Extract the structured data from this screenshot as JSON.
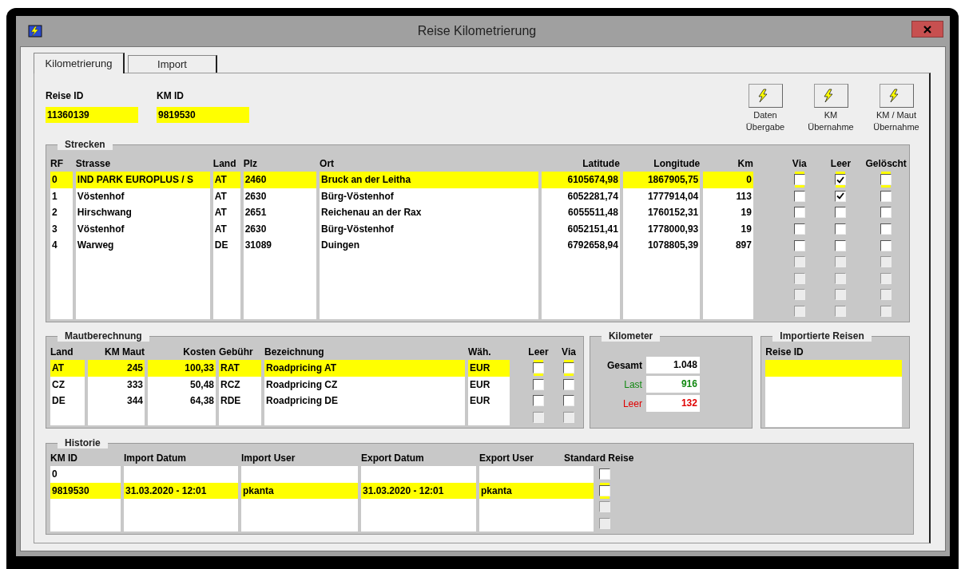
{
  "window": {
    "title": "Reise Kilometrierung"
  },
  "tabs": [
    {
      "label": "Kilometrierung",
      "selected": true
    },
    {
      "label": "Import",
      "selected": false
    }
  ],
  "header_fields": [
    {
      "label": "Reise ID",
      "value": "11360139"
    },
    {
      "label": "KM ID",
      "value": "9819530"
    }
  ],
  "toolbar_buttons": [
    {
      "lines": [
        "Daten",
        "Übergabe"
      ]
    },
    {
      "lines": [
        "KM",
        "Übernahme"
      ]
    },
    {
      "lines": [
        "KM / Maut",
        "Übernahme"
      ]
    }
  ],
  "strecken": {
    "title": "Strecken",
    "columns": [
      "RF",
      "Strasse",
      "Land",
      "Plz",
      "Ort",
      "Latitude",
      "Longitude",
      "Km",
      "Via",
      "Leer",
      "Gelöscht"
    ],
    "rows": [
      {
        "rf": "0",
        "strasse": "IND PARK EUROPLUS / S",
        "land": "AT",
        "plz": "2460",
        "ort": "Bruck an der Leitha",
        "latitude": "6105674,98",
        "longitude": "1867905,75",
        "km": "0",
        "via": false,
        "leer": true,
        "geloescht": false,
        "selected": true,
        "disabled": false
      },
      {
        "rf": "1",
        "strasse": "Vöstenhof",
        "land": "AT",
        "plz": "2630",
        "ort": "Bürg-Vöstenhof",
        "latitude": "6052281,74",
        "longitude": "1777914,04",
        "km": "113",
        "via": false,
        "leer": true,
        "geloescht": false,
        "selected": false,
        "disabled": false
      },
      {
        "rf": "2",
        "strasse": "Hirschwang",
        "land": "AT",
        "plz": "2651",
        "ort": "Reichenau an der Rax",
        "latitude": "6055511,48",
        "longitude": "1760152,31",
        "km": "19",
        "via": false,
        "leer": false,
        "geloescht": false,
        "selected": false,
        "disabled": false
      },
      {
        "rf": "3",
        "strasse": "Vöstenhof",
        "land": "AT",
        "plz": "2630",
        "ort": "Bürg-Vöstenhof",
        "latitude": "6052151,41",
        "longitude": "1778000,93",
        "km": "19",
        "via": false,
        "leer": false,
        "geloescht": false,
        "selected": false,
        "disabled": false
      },
      {
        "rf": "4",
        "strasse": "Warweg",
        "land": "DE",
        "plz": "31089",
        "ort": "Duingen",
        "latitude": "6792658,94",
        "longitude": "1078805,39",
        "km": "897",
        "via": false,
        "leer": false,
        "geloescht": false,
        "selected": false,
        "disabled": false
      },
      {
        "via": false,
        "leer": false,
        "geloescht": false,
        "selected": false,
        "disabled": true
      },
      {
        "via": false,
        "leer": false,
        "geloescht": false,
        "selected": false,
        "disabled": true
      },
      {
        "via": false,
        "leer": false,
        "geloescht": false,
        "selected": false,
        "disabled": true
      },
      {
        "via": false,
        "leer": false,
        "geloescht": false,
        "selected": false,
        "disabled": true
      }
    ]
  },
  "mautberechnung": {
    "title": "Mautberechnung",
    "columns": [
      "Land",
      "KM Maut",
      "Kosten",
      "Gebühr",
      "Bezeichnung",
      "Wäh.",
      "Leer",
      "Via"
    ],
    "rows": [
      {
        "land": "AT",
        "km_maut": "245",
        "kosten": "100,33",
        "gebuehr": "RAT",
        "bezeichnung": "Roadpricing AT",
        "waehrung": "EUR",
        "leer": false,
        "via": false,
        "selected": true,
        "disabled": false
      },
      {
        "land": "CZ",
        "km_maut": "333",
        "kosten": "50,48",
        "gebuehr": "RCZ",
        "bezeichnung": "Roadpricing CZ",
        "waehrung": "EUR",
        "leer": false,
        "via": false,
        "selected": false,
        "disabled": false
      },
      {
        "land": "DE",
        "km_maut": "344",
        "kosten": "64,38",
        "gebuehr": "RDE",
        "bezeichnung": "Roadpricing DE",
        "waehrung": "EUR",
        "leer": false,
        "via": false,
        "selected": false,
        "disabled": false
      },
      {
        "leer": false,
        "via": false,
        "selected": false,
        "disabled": true
      }
    ]
  },
  "kilometer": {
    "title": "Kilometer",
    "rows": [
      {
        "kind": "total",
        "label": "Gesamt",
        "value": "1.048"
      },
      {
        "kind": "last",
        "label": "Last",
        "value": "916"
      },
      {
        "kind": "empty",
        "label": "Leer",
        "value": "132"
      }
    ]
  },
  "importierte_reisen": {
    "title": "Importierte Reisen",
    "columns": [
      "Reise ID"
    ],
    "rows": [
      {
        "selected": true
      }
    ]
  },
  "historie": {
    "title": "Historie",
    "columns": [
      "KM ID",
      "Import Datum",
      "Import User",
      "Export Datum",
      "Export User",
      "Standard Reise"
    ],
    "rows": [
      {
        "km_id": "0",
        "standard_reise": false,
        "selected": false,
        "disabled": false
      },
      {
        "km_id": "9819530",
        "import_datum": "31.03.2020 - 12:01",
        "import_user": "pkanta",
        "export_datum": "31.03.2020 - 12:01",
        "export_user": "pkanta",
        "standard_reise": false,
        "selected": true,
        "disabled": false
      },
      {
        "standard_reise": false,
        "selected": false,
        "disabled": true
      },
      {
        "standard_reise": false,
        "selected": false,
        "disabled": true
      }
    ]
  }
}
